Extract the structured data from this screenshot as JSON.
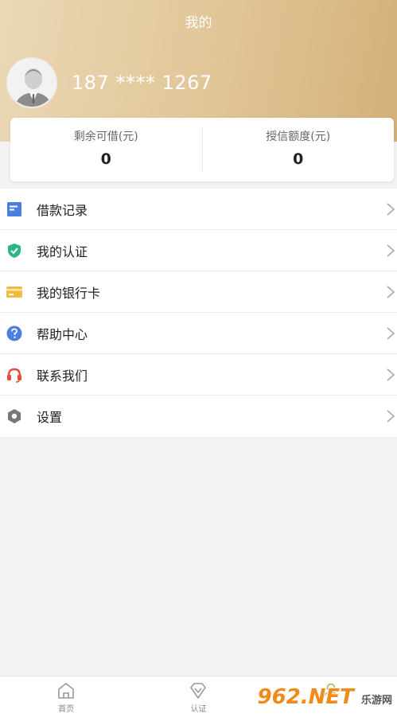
{
  "header": {
    "title": "我的",
    "phone": "187 **** 1267"
  },
  "stats": [
    {
      "label": "剩余可借(元)",
      "value": "0"
    },
    {
      "label": "授信额度(元)",
      "value": "0"
    }
  ],
  "menu": [
    {
      "label": "借款记录",
      "icon": "document-icon",
      "color": "#4a7ee0"
    },
    {
      "label": "我的认证",
      "icon": "shield-check-icon",
      "color": "#2bb686"
    },
    {
      "label": "我的银行卡",
      "icon": "card-icon",
      "color": "#f2bb3f"
    },
    {
      "label": "帮助中心",
      "icon": "help-icon",
      "color": "#4a7ee0"
    },
    {
      "label": "联系我们",
      "icon": "headset-icon",
      "color": "#e2503c"
    },
    {
      "label": "设置",
      "icon": "settings-icon",
      "color": "#777777"
    }
  ],
  "tabs": [
    {
      "label": "首页",
      "icon": "home-icon"
    },
    {
      "label": "认证",
      "icon": "diamond-icon"
    },
    {
      "label": "",
      "icon": "profile-icon"
    }
  ],
  "watermark": {
    "text": "962.NET",
    "sub": "乐游网"
  },
  "colors": {
    "accent": "#d4b07a",
    "tab_active": "#c9a46b"
  }
}
